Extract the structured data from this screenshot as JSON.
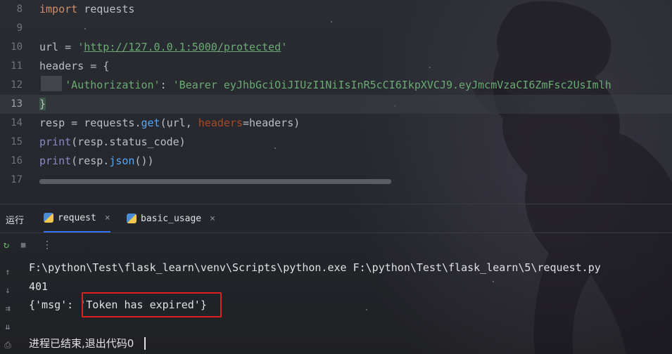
{
  "editor": {
    "lines": [
      {
        "num": "8",
        "tokens": [
          {
            "c": "kw",
            "t": "import"
          },
          {
            "c": "plain",
            "t": " requests"
          }
        ]
      },
      {
        "num": "9",
        "tokens": []
      },
      {
        "num": "10",
        "tokens": [
          {
            "c": "plain",
            "t": "url = "
          },
          {
            "c": "str",
            "t": "'"
          },
          {
            "c": "url",
            "t": "http://127.0.0.1:5000/protected"
          },
          {
            "c": "str",
            "t": "'"
          }
        ]
      },
      {
        "num": "11",
        "tokens": [
          {
            "c": "plain",
            "t": "headers = {"
          }
        ]
      },
      {
        "num": "12",
        "tokens": [
          {
            "c": "plain",
            "t": "    "
          },
          {
            "c": "str",
            "t": "'Authorization'"
          },
          {
            "c": "plain",
            "t": ": "
          },
          {
            "c": "str",
            "t": "'Bearer eyJhbGciOiJIUzI1NiIsInR5cCI6IkpXVCJ9.eyJmcmVzaCI6ZmFsc2UsImlh"
          }
        ]
      },
      {
        "num": "13",
        "tokens": [
          {
            "c": "plain",
            "t": "}"
          }
        ],
        "current": true
      },
      {
        "num": "14",
        "tokens": [
          {
            "c": "plain",
            "t": "resp = requests."
          },
          {
            "c": "fn",
            "t": "get"
          },
          {
            "c": "plain",
            "t": "(url, "
          },
          {
            "c": "param",
            "t": "headers"
          },
          {
            "c": "plain",
            "t": "=headers)"
          }
        ]
      },
      {
        "num": "15",
        "tokens": [
          {
            "c": "bi",
            "t": "print"
          },
          {
            "c": "plain",
            "t": "(resp.status_code)"
          }
        ]
      },
      {
        "num": "16",
        "tokens": [
          {
            "c": "bi",
            "t": "print"
          },
          {
            "c": "plain",
            "t": "(resp."
          },
          {
            "c": "fn",
            "t": "json"
          },
          {
            "c": "plain",
            "t": "())"
          }
        ]
      },
      {
        "num": "17",
        "tokens": []
      }
    ]
  },
  "run_panel": {
    "title": "运行",
    "tabs": [
      {
        "label": "request",
        "active": true
      },
      {
        "label": "basic_usage",
        "active": false
      }
    ],
    "close_glyph": "×"
  },
  "console": {
    "lines": [
      "F:\\python\\Test\\flask_learn\\venv\\Scripts\\python.exe F:\\python\\Test\\flask_learn\\5\\request.py",
      "401",
      "{'msg': 'Token has expired'}",
      "",
      "进程已结束,退出代码0"
    ]
  },
  "icons": {
    "rerun": "↻",
    "stop": "■",
    "more": "⋮",
    "up": "↑",
    "down": "↓",
    "soft_wrap": "⇉",
    "scroll_end": "⇊",
    "print": "⎙"
  },
  "colors": {
    "keyword": "#cf8e6d",
    "string": "#6aab73",
    "function": "#56a8f5",
    "builtin": "#8888c6",
    "param": "#aa4926",
    "annotation_box": "#e02020",
    "active_tab": "#3574f0"
  }
}
